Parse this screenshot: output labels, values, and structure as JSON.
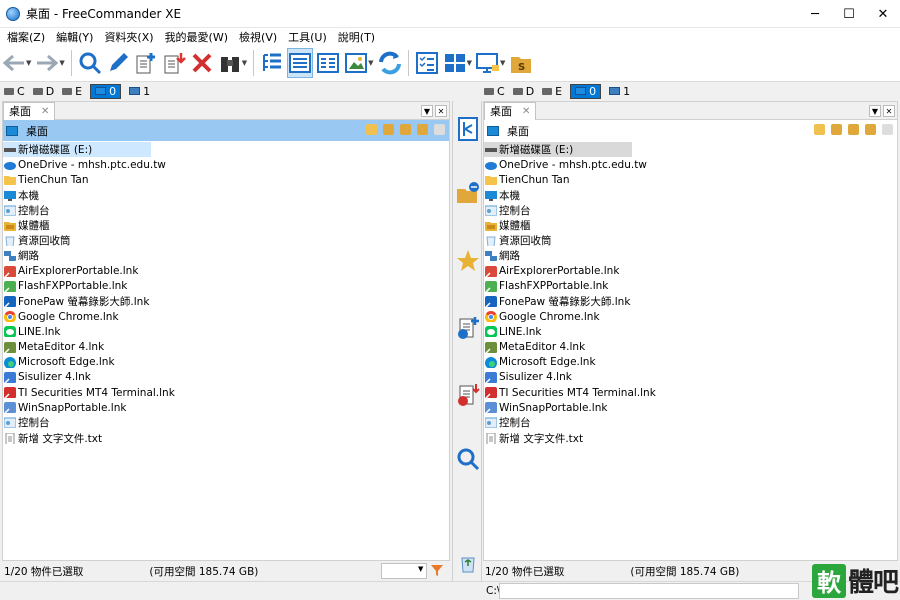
{
  "window": {
    "title": "桌面 - FreeCommander XE",
    "minimize": "─",
    "maximize": "☐",
    "close": "✕"
  },
  "menu": [
    "檔案(Z)",
    "編輯(Y)",
    "資料夾(X)",
    "我的最愛(W)",
    "檢視(V)",
    "工具(U)",
    "說明(T)"
  ],
  "toolbar": {
    "buttons": [
      "back",
      "forward",
      "search",
      "edit",
      "copy",
      "move",
      "delete",
      "binoculars",
      "tree-view",
      "details-view",
      "list-view",
      "thumbnail-view",
      "sync",
      "checklist",
      "layout",
      "monitor",
      "folder-s"
    ]
  },
  "drives": {
    "items": [
      {
        "label": "C",
        "type": "drive"
      },
      {
        "label": "D",
        "type": "drive"
      },
      {
        "label": "E",
        "type": "drive"
      },
      {
        "label": "0",
        "type": "desktop",
        "active": true
      },
      {
        "label": "1",
        "type": "network"
      }
    ]
  },
  "left_panel": {
    "tab_label": "桌面",
    "tab_close": "✕",
    "path_label": "桌面",
    "status_selected": "1/20 物件已選取",
    "status_free": "(可用空間 185.74 GB)"
  },
  "right_panel": {
    "tab_label": "桌面",
    "tab_close": "✕",
    "path_label": "桌面",
    "status_selected": "1/20 物件已選取",
    "status_free": "(可用空間 185.74 GB)"
  },
  "files": [
    {
      "name": "新增磁碟區 (E:)",
      "icon": "drive",
      "color": "#555555"
    },
    {
      "name": "OneDrive - mhsh.ptc.edu.tw",
      "icon": "cloud",
      "color": "#1f7ad8"
    },
    {
      "name": "TienChun Tan",
      "icon": "folder",
      "color": "#f5c24a"
    },
    {
      "name": "本機",
      "icon": "pc",
      "color": "#1a8ad6"
    },
    {
      "name": "控制台",
      "icon": "control-panel",
      "color": "#5aa0d6"
    },
    {
      "name": "媒體櫃",
      "icon": "library",
      "color": "#e8b235"
    },
    {
      "name": "資源回收筒",
      "icon": "recycle",
      "color": "#7fb0d8"
    },
    {
      "name": "網路",
      "icon": "network",
      "color": "#3f7fbf"
    },
    {
      "name": "AirExplorerPortable.lnk",
      "icon": "app",
      "color": "#d94a3a"
    },
    {
      "name": "FlashFXPPortable.lnk",
      "icon": "app",
      "color": "#4caf50"
    },
    {
      "name": "FonePaw 螢幕錄影大師.lnk",
      "icon": "app",
      "color": "#1565c0"
    },
    {
      "name": "Google Chrome.lnk",
      "icon": "chrome",
      "color": "#e94235"
    },
    {
      "name": "LINE.lnk",
      "icon": "line",
      "color": "#06c755"
    },
    {
      "name": "MetaEditor 4.lnk",
      "icon": "app",
      "color": "#6d8f3c"
    },
    {
      "name": "Microsoft Edge.lnk",
      "icon": "edge",
      "color": "#0c8bd6"
    },
    {
      "name": "Sisulizer 4.lnk",
      "icon": "app",
      "color": "#3a7bd5"
    },
    {
      "name": "TI Securities MT4 Terminal.lnk",
      "icon": "app",
      "color": "#d32f2f"
    },
    {
      "name": "WinSnapPortable.lnk",
      "icon": "app",
      "color": "#5c8fd6"
    },
    {
      "name": "控制台",
      "icon": "control-panel",
      "color": "#5aa0d6"
    },
    {
      "name": "新增 文字文件.txt",
      "icon": "text-file",
      "color": "#8e8e8e"
    }
  ],
  "command_line": {
    "label": "C:\\"
  },
  "watermark": {
    "badge": "軟",
    "text": "體吧"
  },
  "colors": {
    "active_path": "#99c9f2",
    "selection": "#cde8ff",
    "accent": "#0078d7"
  }
}
